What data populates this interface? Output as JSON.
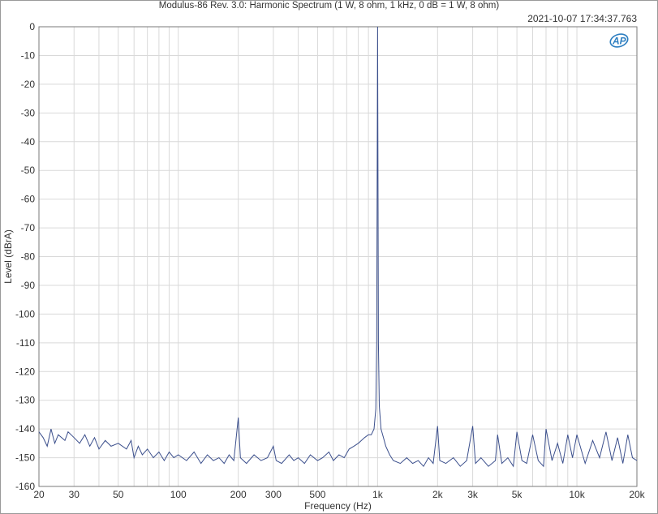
{
  "chart_data": {
    "type": "line",
    "title": "Modulus-86 Rev. 3.0: Harmonic Spectrum (1 W, 8 ohm, 1 kHz, 0 dB = 1 W, 8 ohm)",
    "timestamp": "2021-10-07 17:34:37.763",
    "xlabel": "Frequency (Hz)",
    "ylabel": "Level (dBrA)",
    "xscale": "log",
    "xlim": [
      20,
      20000
    ],
    "ylim": [
      -160,
      0
    ],
    "grid": true,
    "x_tick_labels": [
      {
        "value": 20,
        "label": "20"
      },
      {
        "value": 30,
        "label": "30"
      },
      {
        "value": 50,
        "label": "50"
      },
      {
        "value": 100,
        "label": "100"
      },
      {
        "value": 200,
        "label": "200"
      },
      {
        "value": 300,
        "label": "300"
      },
      {
        "value": 500,
        "label": "500"
      },
      {
        "value": 1000,
        "label": "1k"
      },
      {
        "value": 2000,
        "label": "2k"
      },
      {
        "value": 3000,
        "label": "3k"
      },
      {
        "value": 5000,
        "label": "5k"
      },
      {
        "value": 10000,
        "label": "10k"
      },
      {
        "value": 20000,
        "label": "20k"
      }
    ],
    "y_tick_labels": [
      "0",
      "-10",
      "-20",
      "-30",
      "-40",
      "-50",
      "-60",
      "-70",
      "-80",
      "-90",
      "-100",
      "-110",
      "-120",
      "-130",
      "-140",
      "-150",
      "-160"
    ],
    "line_color": "#3b4f8c",
    "series": [
      {
        "points": [
          [
            20,
            -141
          ],
          [
            21,
            -143
          ],
          [
            22,
            -146
          ],
          [
            23,
            -140
          ],
          [
            24,
            -145
          ],
          [
            25,
            -142
          ],
          [
            27,
            -144
          ],
          [
            28,
            -141
          ],
          [
            30,
            -143
          ],
          [
            32,
            -145
          ],
          [
            34,
            -142
          ],
          [
            36,
            -146
          ],
          [
            38,
            -143
          ],
          [
            40,
            -147
          ],
          [
            43,
            -144
          ],
          [
            46,
            -146
          ],
          [
            50,
            -145
          ],
          [
            55,
            -147
          ],
          [
            58,
            -144
          ],
          [
            60,
            -150
          ],
          [
            63,
            -146
          ],
          [
            66,
            -149
          ],
          [
            70,
            -147
          ],
          [
            75,
            -150
          ],
          [
            80,
            -148
          ],
          [
            85,
            -151
          ],
          [
            90,
            -148
          ],
          [
            95,
            -150
          ],
          [
            100,
            -149
          ],
          [
            110,
            -151
          ],
          [
            120,
            -148
          ],
          [
            130,
            -152
          ],
          [
            140,
            -149
          ],
          [
            150,
            -151
          ],
          [
            160,
            -150
          ],
          [
            170,
            -152
          ],
          [
            180,
            -149
          ],
          [
            190,
            -151
          ],
          [
            200,
            -136
          ],
          [
            205,
            -150
          ],
          [
            220,
            -152
          ],
          [
            240,
            -149
          ],
          [
            260,
            -151
          ],
          [
            280,
            -150
          ],
          [
            300,
            -146
          ],
          [
            310,
            -151
          ],
          [
            330,
            -152
          ],
          [
            360,
            -149
          ],
          [
            380,
            -151
          ],
          [
            400,
            -150
          ],
          [
            430,
            -152
          ],
          [
            460,
            -149
          ],
          [
            500,
            -151
          ],
          [
            530,
            -150
          ],
          [
            570,
            -148
          ],
          [
            600,
            -151
          ],
          [
            640,
            -149
          ],
          [
            680,
            -150
          ],
          [
            720,
            -147
          ],
          [
            760,
            -146
          ],
          [
            800,
            -145
          ],
          [
            830,
            -144
          ],
          [
            860,
            -143
          ],
          [
            900,
            -142
          ],
          [
            930,
            -142
          ],
          [
            960,
            -140
          ],
          [
            980,
            -133
          ],
          [
            990,
            -110
          ],
          [
            1000,
            0
          ],
          [
            1010,
            -110
          ],
          [
            1020,
            -132
          ],
          [
            1040,
            -140
          ],
          [
            1070,
            -143
          ],
          [
            1100,
            -146
          ],
          [
            1150,
            -149
          ],
          [
            1200,
            -151
          ],
          [
            1300,
            -152
          ],
          [
            1400,
            -150
          ],
          [
            1500,
            -152
          ],
          [
            1600,
            -151
          ],
          [
            1700,
            -153
          ],
          [
            1800,
            -150
          ],
          [
            1900,
            -152
          ],
          [
            2000,
            -139
          ],
          [
            2050,
            -151
          ],
          [
            2200,
            -152
          ],
          [
            2400,
            -150
          ],
          [
            2600,
            -153
          ],
          [
            2800,
            -151
          ],
          [
            3000,
            -139
          ],
          [
            3100,
            -152
          ],
          [
            3300,
            -150
          ],
          [
            3600,
            -153
          ],
          [
            3900,
            -151
          ],
          [
            4000,
            -142
          ],
          [
            4200,
            -152
          ],
          [
            4500,
            -150
          ],
          [
            4800,
            -153
          ],
          [
            5000,
            -141
          ],
          [
            5300,
            -151
          ],
          [
            5600,
            -152
          ],
          [
            6000,
            -142
          ],
          [
            6400,
            -151
          ],
          [
            6800,
            -153
          ],
          [
            7000,
            -140
          ],
          [
            7500,
            -151
          ],
          [
            8000,
            -145
          ],
          [
            8500,
            -152
          ],
          [
            9000,
            -142
          ],
          [
            9500,
            -150
          ],
          [
            10000,
            -142
          ],
          [
            11000,
            -152
          ],
          [
            12000,
            -144
          ],
          [
            13000,
            -150
          ],
          [
            14000,
            -141
          ],
          [
            15000,
            -151
          ],
          [
            16000,
            -143
          ],
          [
            17000,
            -152
          ],
          [
            18000,
            -142
          ],
          [
            19000,
            -150
          ],
          [
            20000,
            -151
          ]
        ]
      }
    ]
  }
}
